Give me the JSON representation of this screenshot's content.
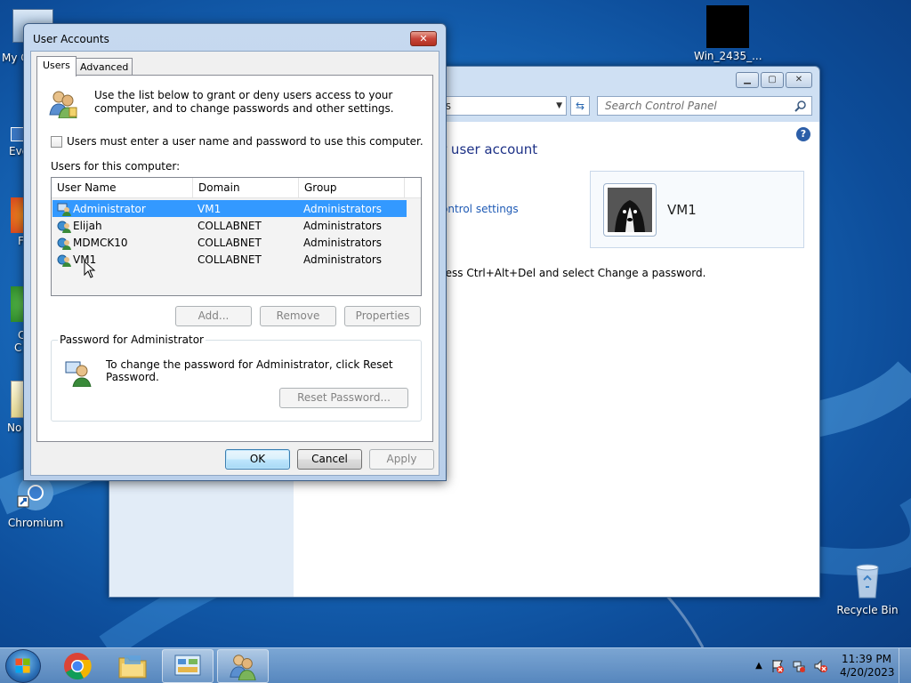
{
  "desktop": {
    "icons": {
      "computer_partial": "My C",
      "everything_partial": "Eve",
      "firefox_partial": "F",
      "c_partial_1": "C",
      "c_partial_2": "C",
      "notepad_partial": "No",
      "chromium": "Chromium",
      "win_vm": "Win_2435_...",
      "recycle_bin": "Recycle Bin"
    }
  },
  "control_panel": {
    "address_text": "ts",
    "search_placeholder": "Search Control Panel",
    "heading_partial": "r user account",
    "link_partial": "ontrol settings",
    "note_partial": "ress Ctrl+Alt+Del and select Change a password.",
    "user_name": "VM1"
  },
  "dialog": {
    "title": "User Accounts",
    "tabs": [
      {
        "label": "Users",
        "active": true
      },
      {
        "label": "Advanced",
        "active": false
      }
    ],
    "intro": "Use the list below to grant or deny users access to your computer, and to change passwords and other settings.",
    "checkbox_label": "Users must enter a user name and password to use this computer.",
    "checkbox_checked": false,
    "users_label": "Users for this computer:",
    "columns": [
      "User Name",
      "Domain",
      "Group"
    ],
    "rows": [
      {
        "name": "Administrator",
        "domain": "VM1",
        "group": "Administrators",
        "selected": true
      },
      {
        "name": "Elijah",
        "domain": "COLLABNET",
        "group": "Administrators",
        "selected": false
      },
      {
        "name": "MDMCK10",
        "domain": "COLLABNET",
        "group": "Administrators",
        "selected": false
      },
      {
        "name": "VM1",
        "domain": "COLLABNET",
        "group": "Administrators",
        "selected": false
      }
    ],
    "buttons": {
      "add": "Add...",
      "remove": "Remove",
      "properties": "Properties",
      "reset_password": "Reset Password...",
      "ok": "OK",
      "cancel": "Cancel",
      "apply": "Apply"
    },
    "password_group_label": "Password for Administrator",
    "password_text": "To change the password for Administrator, click Reset Password."
  },
  "taskbar": {
    "time": "11:39 PM",
    "date": "4/20/2023"
  },
  "colors": {
    "selection": "#3399ff",
    "link": "#1e5ab5",
    "heading": "#1e3287"
  }
}
